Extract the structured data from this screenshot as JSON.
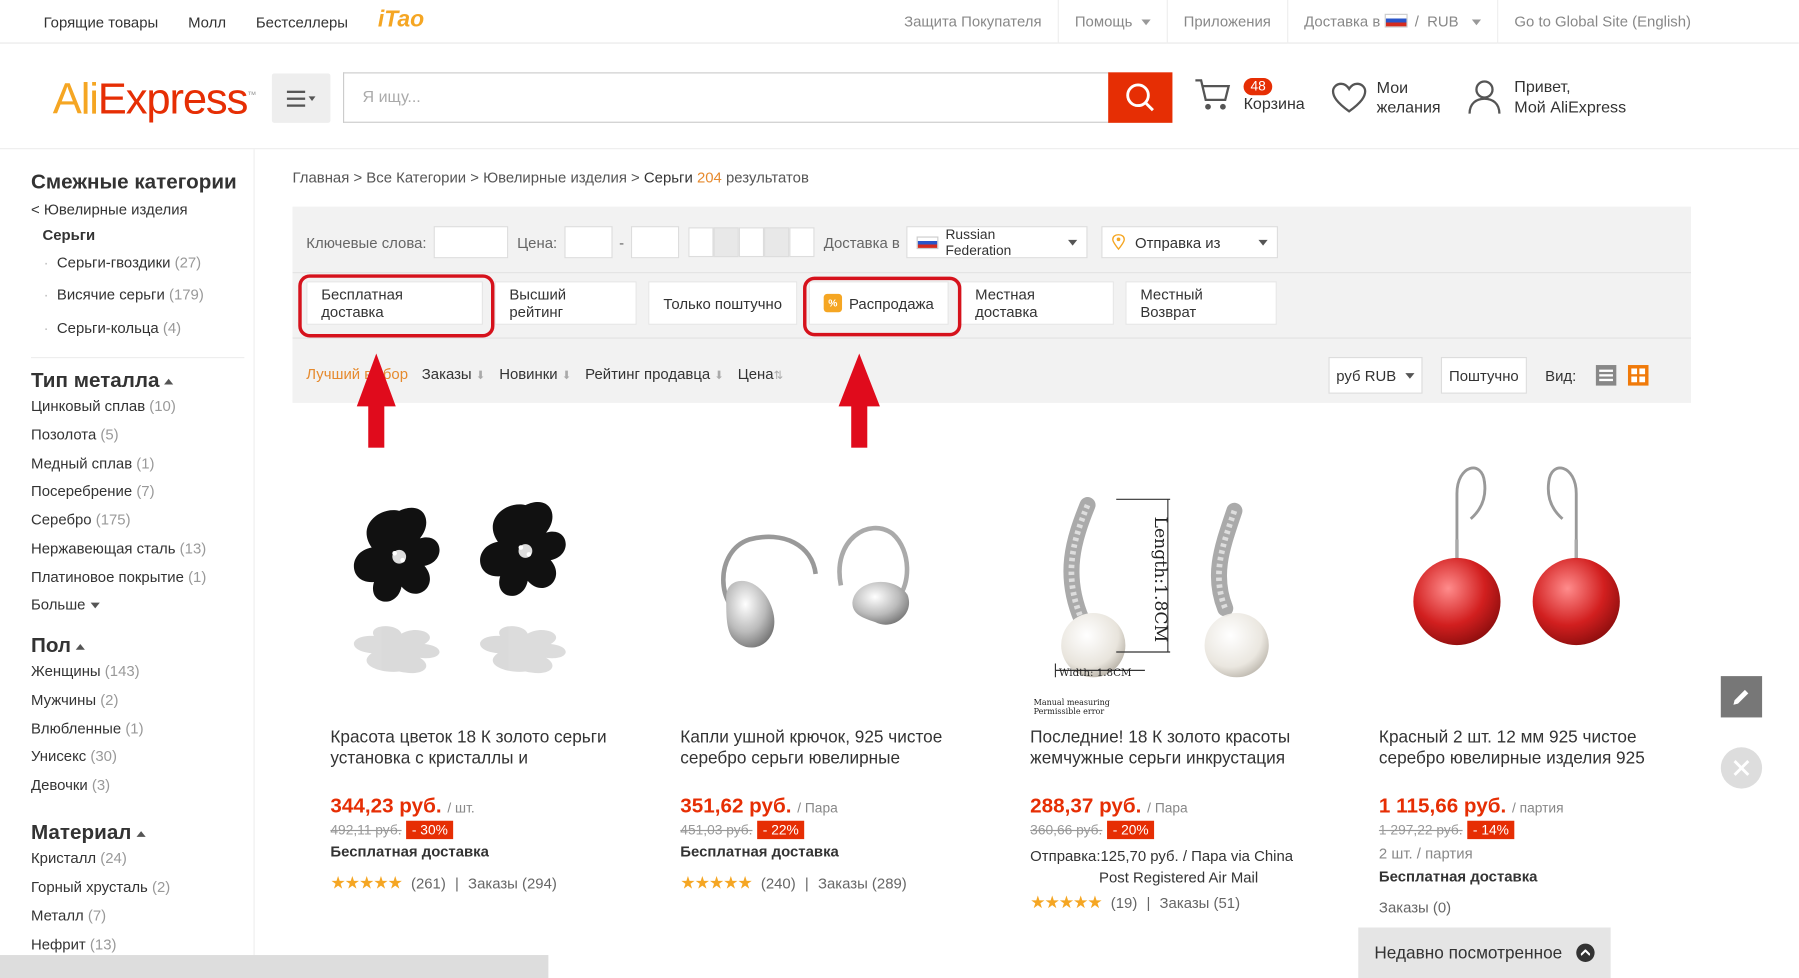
{
  "topbar": {
    "links": [
      "Горящие товары",
      "Молл",
      "Бестселлеры"
    ],
    "taobao_logo": "iTao",
    "buyer_protection": "Защита Покупателя",
    "help": "Помощь",
    "apps": "Приложения",
    "ship_to": "Доставка в",
    "currency": "RUB",
    "global_site": "Go to Global Site (English)"
  },
  "header": {
    "logo_ali": "Ali",
    "logo_express": "Express",
    "logo_tm": "™",
    "search_placeholder": "Я ищу...",
    "cart_count": "48",
    "cart_label": "Корзина",
    "wish_line1": "Мои",
    "wish_line2": "желания",
    "account_line1": "Привет,",
    "account_line2": "Мой AliExpress"
  },
  "sidebar": {
    "related_title": "Смежные категории",
    "parent": "< Ювелирные изделия",
    "current": "Серьги",
    "subcats": [
      {
        "label": "Серьги-гвоздики",
        "count": "(27)"
      },
      {
        "label": "Висячие серьги",
        "count": "(179)"
      },
      {
        "label": "Серьги-кольца",
        "count": "(4)"
      }
    ],
    "metal_title": "Тип металла",
    "metals": [
      {
        "label": "Цинковый сплав",
        "count": "(10)"
      },
      {
        "label": "Позолота",
        "count": "(5)"
      },
      {
        "label": "Медный сплав",
        "count": "(1)"
      },
      {
        "label": "Посеребрение",
        "count": "(7)"
      },
      {
        "label": "Серебро",
        "count": "(175)"
      },
      {
        "label": "Нержавеющая сталь",
        "count": "(13)"
      },
      {
        "label": "Платиновое покрытие",
        "count": "(1)"
      }
    ],
    "more": "Больше",
    "gender_title": "Пол",
    "genders": [
      {
        "label": "Женщины",
        "count": "(143)"
      },
      {
        "label": "Мужчины",
        "count": "(2)"
      },
      {
        "label": "Влюбленные",
        "count": "(1)"
      },
      {
        "label": "Унисекс",
        "count": "(30)"
      },
      {
        "label": "Девочки",
        "count": "(3)"
      }
    ],
    "material_title": "Материал",
    "materials": [
      {
        "label": "Кристалл",
        "count": "(24)"
      },
      {
        "label": "Горный хрусталь",
        "count": "(2)"
      },
      {
        "label": "Металл",
        "count": "(7)"
      },
      {
        "label": "Нефрит",
        "count": "(13)"
      }
    ]
  },
  "breadcrumb": {
    "path": "Главная > Все Категории > Ювелирные изделия > ",
    "current": "Серьги",
    "count": "204",
    "results": "результатов"
  },
  "filters": {
    "keywords_label": "Ключевые слова:",
    "price_label": "Цена:",
    "dash": "-",
    "ship_to_label": "Доставка в",
    "country": "Russian Federation",
    "ships_from": "Отправка из",
    "chips": [
      "Бесплатная доставка",
      "Высший рейтинг",
      "Только поштучно",
      "Распродажа",
      "Местная доставка",
      "Местный Возврат"
    ],
    "sale_icon": "%",
    "sort": [
      "Лучший выбор",
      "Заказы",
      "Новинки",
      "Рейтинг продавца",
      "Цена"
    ],
    "currency_select": "руб RUB",
    "unit_select": "Поштучно",
    "view_label": "Вид:"
  },
  "products": [
    {
      "title": "Красота цветок 18 К золото серьги установка с кристаллы и",
      "price": "344,23 руб.",
      "unit": "/ шт.",
      "old_price": "492,11 руб.",
      "discount": "- 30%",
      "shipping": "Бесплатная доставка",
      "reviews": "(261)",
      "sep": "|",
      "orders": "Заказы (294)"
    },
    {
      "title": "Капли ушной крючок, 925 чистое серебро серьги ювелирные",
      "price": "351,62 руб.",
      "unit": "/ Пара",
      "old_price": "451,03 руб.",
      "discount": "- 22%",
      "shipping": "Бесплатная доставка",
      "reviews": "(240)",
      "sep": "|",
      "orders": "Заказы (289)"
    },
    {
      "title": "Последние! 18 К золото красоты жемчужные серьги инкрустация",
      "price": "288,37 руб.",
      "unit": "/ Пара",
      "old_price": "360,66 руб.",
      "discount": "- 20%",
      "shipping_line1": "Отправка:125,70 руб. / Пара via China",
      "shipping_line2": "Post Registered Air Mail",
      "reviews": "(19)",
      "sep": "|",
      "orders": "Заказы (51)",
      "img_length_label": "Length:1.8CM",
      "img_width_label": "Width: 1.8CM",
      "img_note1": "Manual measuring",
      "img_note2": "Permissible error"
    },
    {
      "title": "Красный 2 шт. 12 мм 925 чистое серебро ювелирные изделия 925",
      "price": "1 115,66 руб.",
      "unit": "/ партия",
      "old_price": "1 297,22 руб.",
      "discount": "- 14%",
      "lot_info": "2 шт. / партия",
      "shipping": "Бесплатная доставка",
      "orders": "Заказы (0)"
    }
  ],
  "recently_viewed": "Недавно посмотренное",
  "colors": {
    "accent": "#e62e04",
    "orange": "#e68a2e",
    "highlight": "#d6121c",
    "star": "#f5a623"
  }
}
